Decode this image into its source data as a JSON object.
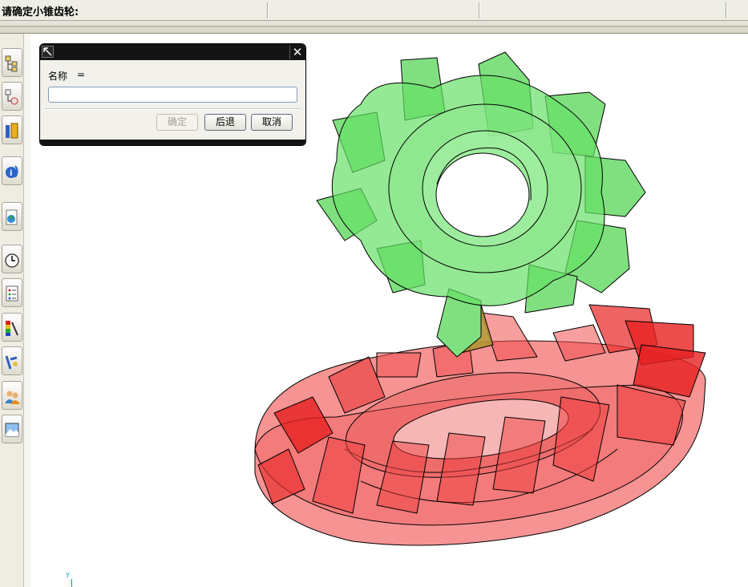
{
  "prompt": {
    "text": "请确定小锥齿轮:"
  },
  "dialog": {
    "name_label": "名称",
    "equals": "=",
    "name_value": "",
    "ok_label": "确定",
    "back_label": "后退",
    "cancel_label": "取消",
    "close_glyph": "✕"
  },
  "triad": {
    "y_label": "Y"
  },
  "resource_bar": {
    "icons": [
      "assembly-navigator-icon",
      "part-navigator-icon",
      "reuse-library-icon",
      "roles-info-icon",
      "web-browser-icon",
      "history-icon",
      "process-navigator-icon",
      "palette-icon",
      "system-materials-icon",
      "roles-icon",
      "image-gallery-icon"
    ]
  },
  "colors": {
    "pinion_fill": "#66e066",
    "gear_fill": "#ee3b3b",
    "dialog_title": "#141414"
  }
}
